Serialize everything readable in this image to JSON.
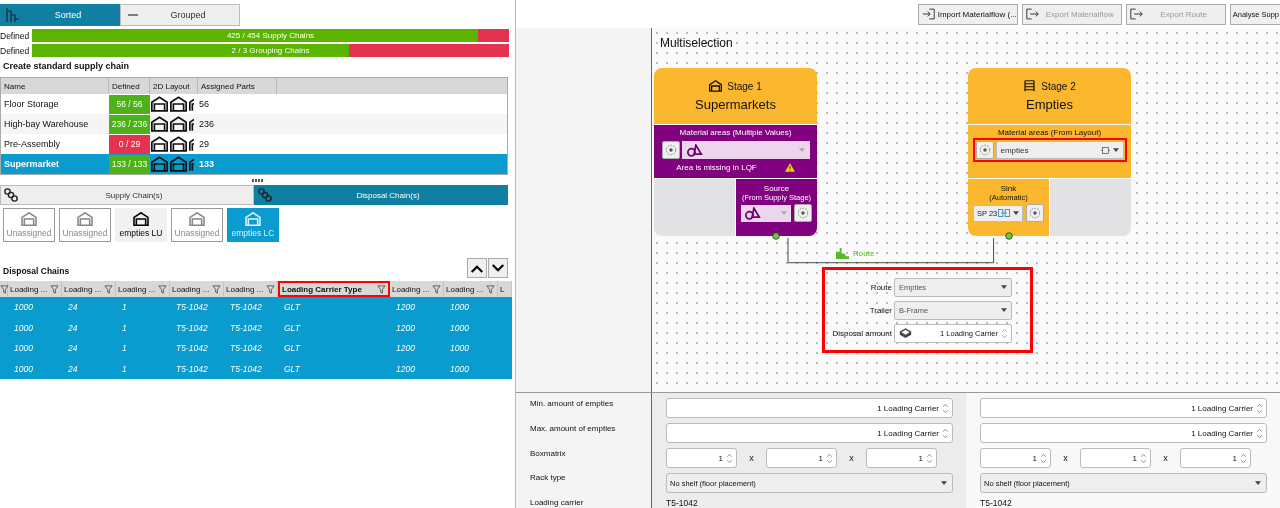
{
  "view_toggle": [
    {
      "label": "Sorted",
      "selected": true
    },
    {
      "label": "Grouped",
      "selected": false
    }
  ],
  "progress": [
    {
      "label": "Defined",
      "text": "425 / 454 Supply Chains",
      "level": 0.936
    },
    {
      "label": "Defined",
      "text": "2 / 3 Grouping Chains",
      "level": 0.665
    }
  ],
  "standard_chains": {
    "title": "Create standard supply chain",
    "columns": [
      "Name",
      "Defined",
      "2D Layout",
      "Assigned Parts"
    ],
    "rows": [
      {
        "name": "Floor Storage",
        "defined": "56 / 56",
        "complete": true,
        "parts": "56",
        "selected": false
      },
      {
        "name": "High-bay Warehouse",
        "defined": "236 / 236",
        "complete": true,
        "parts": "236",
        "selected": false
      },
      {
        "name": "Pre-Assembly",
        "defined": "0 / 29",
        "complete": false,
        "parts": "29",
        "selected": false
      },
      {
        "name": "Supermarket",
        "defined": "133 / 133",
        "complete": true,
        "parts": "133",
        "selected": true
      }
    ]
  },
  "chain_tabs": [
    {
      "label": "Supply Chain(s)",
      "selected": false
    },
    {
      "label": "Disposal Chain(s)",
      "selected": true
    }
  ],
  "areas": [
    {
      "label": "Unassigned",
      "assigned": false,
      "selected": false
    },
    {
      "label": "Unassigned",
      "assigned": false,
      "selected": false
    },
    {
      "label": "empties LU",
      "assigned": true,
      "selected": false
    },
    {
      "label": "Unassigned",
      "assigned": false,
      "selected": false
    },
    {
      "label": "empties LC",
      "assigned": true,
      "selected": true
    }
  ],
  "disposal": {
    "title": "Disposal Chains",
    "columns": [
      {
        "label": "Loading ...",
        "highlighted": false
      },
      {
        "label": "Loading ...",
        "highlighted": false
      },
      {
        "label": "Loading ...",
        "highlighted": false
      },
      {
        "label": "Loading ...",
        "highlighted": false
      },
      {
        "label": "Loading ...",
        "highlighted": false
      },
      {
        "label": "Loading Carrier Type",
        "highlighted": true
      },
      {
        "label": "Loading ...",
        "highlighted": false
      },
      {
        "label": "Loading ...",
        "highlighted": false
      },
      {
        "label": "L",
        "highlighted": false
      }
    ],
    "rows": [
      {
        "selected": true,
        "cells": [
          "1000",
          "24",
          "1",
          "T5-1042",
          "T5-1042",
          "GLT",
          "1200",
          "1000"
        ]
      },
      {
        "selected": true,
        "cells": [
          "1000",
          "24",
          "1",
          "T5-1042",
          "T5-1042",
          "GLT",
          "1200",
          "1000"
        ]
      },
      {
        "selected": true,
        "cells": [
          "1000",
          "24",
          "1",
          "T5-1042",
          "T5-1042",
          "GLT",
          "1200",
          "1000"
        ]
      },
      {
        "selected": true,
        "cells": [
          "1000",
          "24",
          "1",
          "T5-1042",
          "T5-1042",
          "GLT",
          "1200",
          "1000"
        ]
      }
    ]
  },
  "toolbar": [
    {
      "label": "Import Materialflow (...",
      "disabled": false
    },
    {
      "label": "Export Materialflow",
      "disabled": true
    },
    {
      "label": "Export Route",
      "disabled": true
    },
    {
      "label": "Analyse Supp",
      "disabled": false
    }
  ],
  "canvas": {
    "title": "Multiselection",
    "stages": [
      {
        "kind": "supply",
        "stage": "Stage 1",
        "name": "Supermarkets",
        "areas_label": "Material areas (Multiple Values)",
        "warning": "Area is missing in LQF",
        "highlighted": false,
        "endpoint": {
          "title": "Source",
          "subtitle": "(From Supply Stage)"
        }
      },
      {
        "kind": "disposal",
        "stage": "Stage 2",
        "name": "Empties",
        "areas_label": "Material areas (From Layout)",
        "areas_value": "empties",
        "highlighted": true,
        "endpoint": {
          "title": "Sink",
          "subtitle": "(Automatic)",
          "value": "SP 23"
        }
      }
    ],
    "route_label": "Route",
    "route": {
      "highlighted": true,
      "rows": [
        {
          "kind": "select",
          "label": "Route",
          "value": "Empties"
        },
        {
          "kind": "select",
          "label": "Trailer",
          "value": "B-Frame"
        },
        {
          "kind": "amount",
          "label": "Disposal amount",
          "value": "1 Loading Carrier"
        }
      ]
    }
  },
  "properties": {
    "labels": [
      "Min. amount of empties",
      "Max. amount of empties",
      "Boxmatrix",
      "Rack type",
      "Loading carrier"
    ],
    "columns": [
      {
        "min": "1 Loading Carrier",
        "max": "1 Loading Carrier",
        "boxmatrix": [
          "1",
          "1",
          "1"
        ],
        "separators": [
          "x",
          "x"
        ],
        "rack": "No shelf (floor placement)",
        "carrier": "T5-1042"
      },
      {
        "min": "1 Loading Carrier",
        "max": "1 Loading Carrier",
        "boxmatrix": [
          "1",
          "1",
          "1"
        ],
        "separators": [
          "x",
          "x"
        ],
        "rack": "No shelf (floor placement)",
        "carrier": "T5-1042"
      }
    ]
  }
}
